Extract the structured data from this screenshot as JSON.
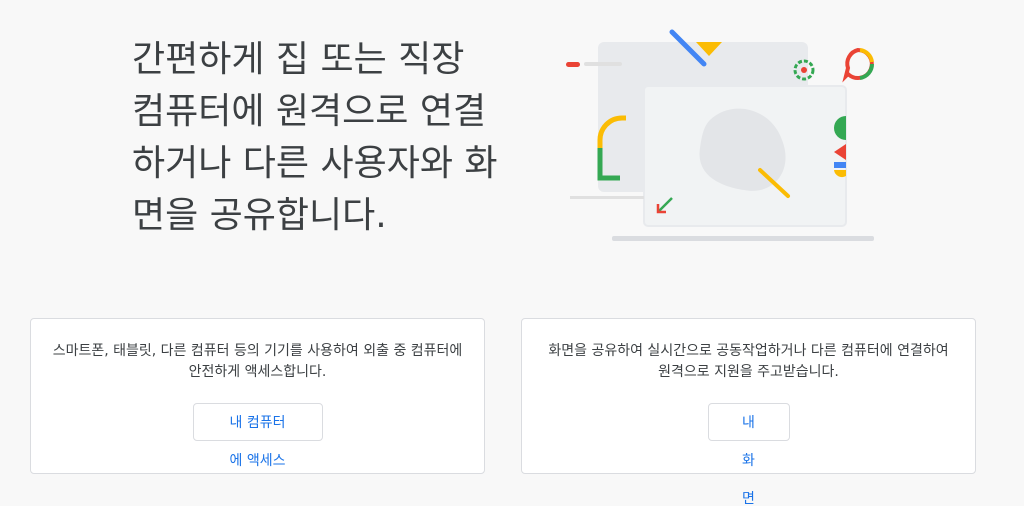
{
  "hero": {
    "title": "간편하게 집 또는 직장\n컴퓨터에 원격으로 연결\n하거나 다른 사용자와 화\n면을 공유합니다."
  },
  "cards": [
    {
      "description": "스마트폰, 태블릿, 다른 컴퓨터 등의 기기를 사용하여 외출 중 컴퓨터에 안전하게 액세스합니다.",
      "button_label": "내 컴퓨터에 액세스"
    },
    {
      "description": "화면을 공유하여 실시간으로 공동작업하거나 다른 컴퓨터에 연결하여 원격으로 지원을 주고받습니다.",
      "button_label": "내 화면 공유"
    }
  ],
  "colors": {
    "accent_blue": "#1a73e8",
    "google_red": "#ea4335",
    "google_yellow": "#fbbc04",
    "google_green": "#34a853",
    "google_blue": "#4285f4"
  }
}
